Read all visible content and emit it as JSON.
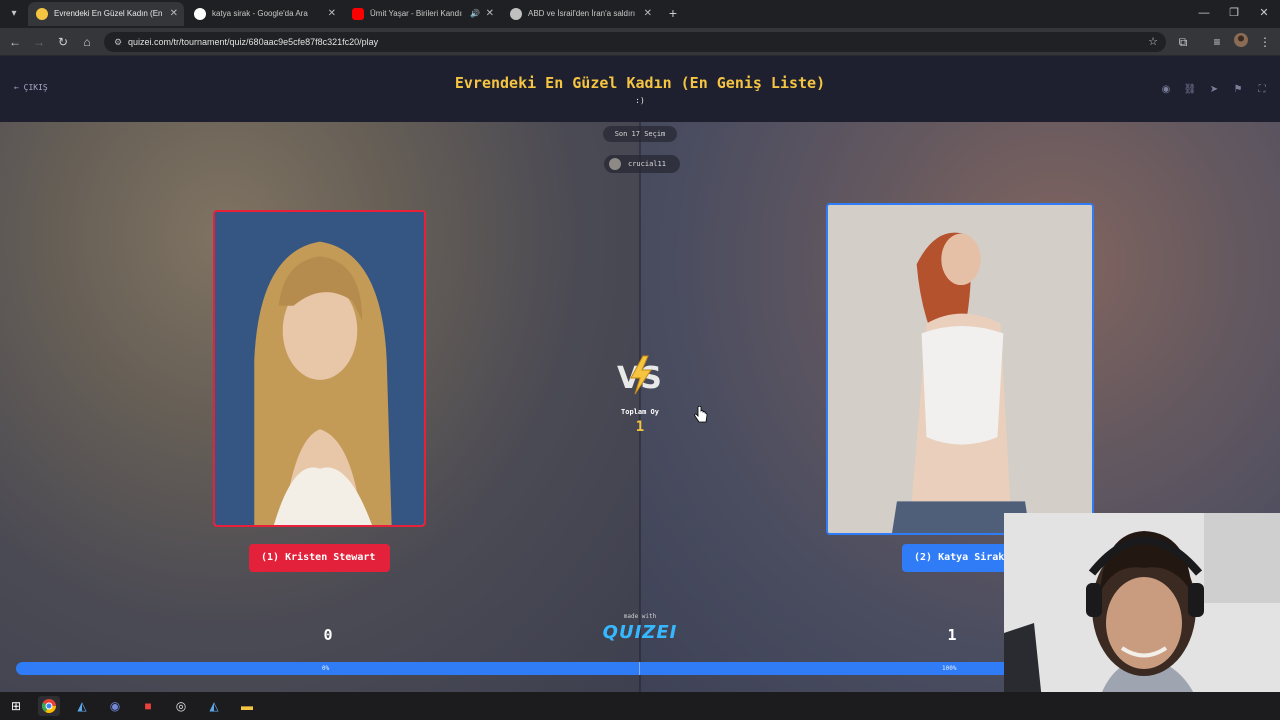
{
  "browser": {
    "tabs": [
      {
        "title": "Evrendeki En Güzel Kadın (En G",
        "active": true,
        "favicon_color": "#f5c542"
      },
      {
        "title": "katya sirak - Google'da Ara",
        "active": false,
        "favicon_color": "#4285f4"
      },
      {
        "title": "Ümit Yaşar - Birileri Kandırm",
        "active": false,
        "favicon_color": "#ff0000"
      },
      {
        "title": "ABD ve İsrail'den İran'a saldırı",
        "active": false,
        "favicon_color": "#c0c0c0"
      }
    ],
    "url": "quizei.com/tr/tournament/quiz/680aac9e5cfe87f8c321fc20/play"
  },
  "header": {
    "exit_label": "ÇIKIŞ",
    "title": "Evrendeki En Güzel Kadın (En Geniş Liste)",
    "subtitle": ":)"
  },
  "info": {
    "recent_label": "Son 17 Seçim",
    "username": "crucial11"
  },
  "match": {
    "left": {
      "label": "(1) Kristen Stewart",
      "score": "0",
      "percent": "0%",
      "share": 0
    },
    "right": {
      "label": "(2) Katya Sirak",
      "score": "1",
      "percent": "100%",
      "share": 1
    },
    "vs_label": "VS",
    "total_label": "Toplam Oy",
    "total_count": "1"
  },
  "footer": {
    "made_with": "made with",
    "brand": "QUIZEI"
  },
  "colors": {
    "accent_yellow": "#f5c542",
    "left_red": "#e3213a",
    "right_blue": "#2f7cf6"
  }
}
